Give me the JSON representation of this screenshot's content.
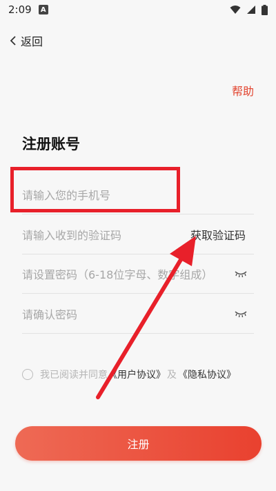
{
  "status_bar": {
    "time": "2:09",
    "notification_badge": "A",
    "icons": [
      "wifi-icon",
      "signal-icon",
      "battery-icon"
    ]
  },
  "nav": {
    "back_label": "返回",
    "help_label": "帮助"
  },
  "page": {
    "title": "注册账号"
  },
  "form": {
    "phone_placeholder": "请输入您的手机号",
    "code_placeholder": "请输入收到的验证码",
    "get_code_label": "获取验证码",
    "password_placeholder": "请设置密码（6-18位字母、数字组成）",
    "confirm_placeholder": "请确认密码"
  },
  "agreement": {
    "text": "我已阅读并同意",
    "user_agreement": "《用户协议》",
    "and": "及",
    "privacy_policy": "《隐私协议》"
  },
  "submit_label": "注册",
  "colors": {
    "accent": "#e2442f",
    "annotation": "#e8202a"
  }
}
